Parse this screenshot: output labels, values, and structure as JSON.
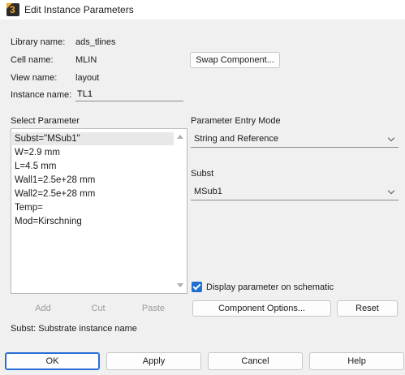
{
  "window": {
    "title": "Edit Instance Parameters",
    "app_icon": "ads-logo-icon"
  },
  "info": {
    "library_label": "Library name:",
    "library_value": "ads_tlines",
    "cell_label": "Cell name:",
    "cell_value": "MLIN",
    "view_label": "View name:",
    "view_value": "layout",
    "instance_label": "Instance name:",
    "instance_value": "TL1"
  },
  "buttons": {
    "swap": "Swap Component...",
    "add": "Add",
    "cut": "Cut",
    "paste": "Paste",
    "component_options": "Component Options...",
    "reset": "Reset",
    "ok": "OK",
    "apply": "Apply",
    "cancel": "Cancel",
    "help": "Help"
  },
  "select_parameter": {
    "label": "Select Parameter",
    "items": [
      "Subst=\"MSub1\"",
      "W=2.9 mm",
      "L=4.5 mm",
      "Wall1=2.5e+28 mm",
      "Wall2=2.5e+28 mm",
      "Temp=",
      "Mod=Kirschning"
    ],
    "selected_index": 0
  },
  "entry_mode": {
    "label": "Parameter Entry Mode",
    "value": "String and Reference"
  },
  "subst": {
    "label": "Subst",
    "value": "MSub1"
  },
  "display_checkbox": {
    "label": "Display parameter on schematic",
    "checked": true
  },
  "status": "Subst: Substrate instance name",
  "colors": {
    "accent": "#1f6fd1",
    "background": "#f0f0f0"
  }
}
